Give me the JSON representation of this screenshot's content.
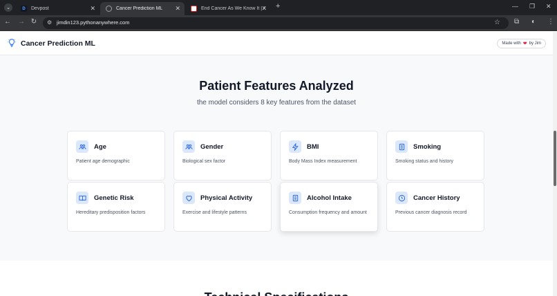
{
  "browser": {
    "tabs": [
      {
        "title": "Devpost",
        "favicon": "D",
        "active": false
      },
      {
        "title": "Cancer Prediction ML",
        "favicon": "",
        "active": true
      },
      {
        "title": "End Cancer As We Know It | Am",
        "favicon": "",
        "active": false
      }
    ],
    "url": "jimdin123.pythonanywhere.com"
  },
  "site": {
    "title": "Cancer Prediction ML",
    "made_with": "Made with",
    "by": "by Jim"
  },
  "section": {
    "title": "Patient Features Analyzed",
    "subtitle": "the model considers 8 key features from the dataset"
  },
  "features": [
    {
      "title": "Age",
      "desc": "Patient age demographic",
      "icon": "users-icon"
    },
    {
      "title": "Gender",
      "desc": "Biological sex factor",
      "icon": "users-icon"
    },
    {
      "title": "BMI",
      "desc": "Body Mass Index measurement",
      "icon": "activity-icon"
    },
    {
      "title": "Smoking",
      "desc": "Smoking status and history",
      "icon": "building-icon"
    },
    {
      "title": "Genetic Risk",
      "desc": "Hereditary predisposition factors",
      "icon": "book-icon"
    },
    {
      "title": "Physical Activity",
      "desc": "Exercise and lifestyle patterns",
      "icon": "heart-icon"
    },
    {
      "title": "Alcohol Intake",
      "desc": "Consumption frequency and amount",
      "icon": "building-icon"
    },
    {
      "title": "Cancer History",
      "desc": "Previous cancer diagnosis record",
      "icon": "clock-icon"
    }
  ],
  "next_section": {
    "title": "Technical Specifications"
  },
  "colors": {
    "accent": "#2563eb",
    "icon_bg": "#dbe7fb",
    "heart": "#e11d48"
  }
}
